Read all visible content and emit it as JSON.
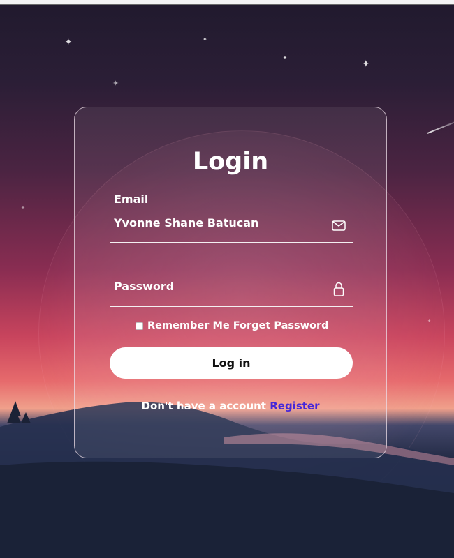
{
  "login": {
    "title": "Login",
    "email_label": "Email",
    "email_value": "Yvonne Shane Batucan",
    "password_label": "Password",
    "remember_label": "Remember Me",
    "forget_label": "Forget Password",
    "login_button": "Log in",
    "no_account_text": "Don't have a account",
    "register_link": "Register"
  },
  "icons": {
    "email": "envelope-icon",
    "password": "lock-icon",
    "decor": [
      "star-icon",
      "shooting-star"
    ]
  },
  "colors": {
    "register_link": "#4527d9",
    "button_bg": "#ffffff",
    "text": "#ffffff"
  }
}
